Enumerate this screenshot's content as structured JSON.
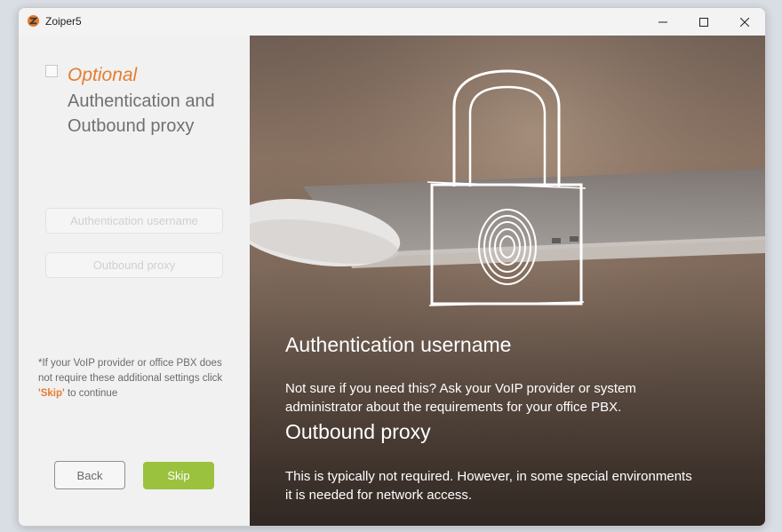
{
  "window": {
    "title": "Zoiper5"
  },
  "left": {
    "optional_label": "Optional",
    "section_title": "Authentication and Outbound proxy",
    "auth_username_placeholder": "Authentication username",
    "outbound_proxy_placeholder": "Outbound proxy",
    "note_prefix": "*If your VoIP provider or office PBX does not require these additional settings click ",
    "note_skip": "'Skip'",
    "note_suffix": " to continue",
    "back_label": "Back",
    "skip_label": "Skip"
  },
  "right": {
    "heading1": "Authentication username",
    "text1": "Not sure if you need this? Ask your VoIP provider or system administrator about the requirements for your office PBX.",
    "heading2": "Outbound proxy",
    "text2": "This is typically not required. However, in some special environments it is needed for network access."
  },
  "colors": {
    "accent_orange": "#e57d2e",
    "skip_green": "#9bc23e"
  }
}
